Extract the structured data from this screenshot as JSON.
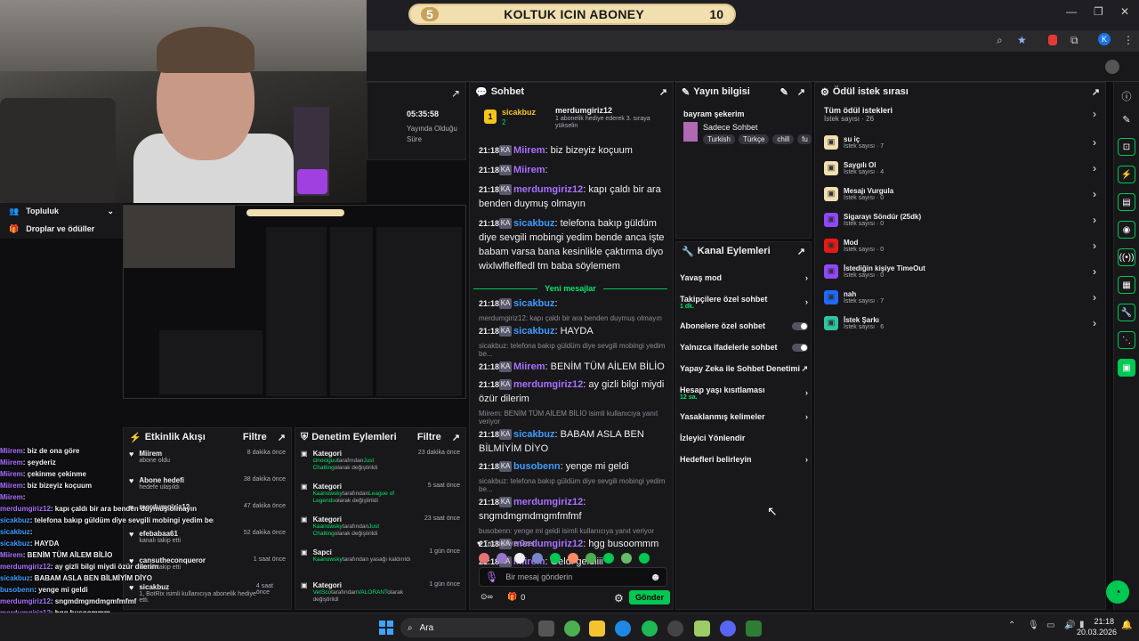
{
  "goal_bar": {
    "left_value": "5",
    "label": "KOLTUK ICIN ABONEY",
    "right_value": "10"
  },
  "stream_info": {
    "uptime": "05:35:58",
    "uptime_label": "Yayında Olduğu Süre"
  },
  "left_nav": {
    "community": "Topluluk",
    "drops": "Droplar ve ödüller"
  },
  "chat": {
    "title": "Sohbet",
    "pinned": {
      "user": "sicakbuz",
      "count": "2",
      "recipient": "merdumgiriz12",
      "text": "1 abonelik hediye ederek 3. sıraya yükselin",
      "rank": "1"
    },
    "messages": [
      {
        "time": "21:18",
        "user": "Miirem",
        "text": ": biz bizeyiz koçuum",
        "color": "#a970ff"
      },
      {
        "time": "21:18",
        "user": "Miirem",
        "text": ":",
        "color": "#a970ff"
      },
      {
        "time": "21:18",
        "user": "merdumgiriz12",
        "text": ": kapı çaldı bir ara benden duymuş olmayın",
        "color": "#a970ff"
      },
      {
        "time": "21:18",
        "user": "sicakbuz",
        "text": ": telefona bakıp güldüm diye sevgili mobingi yedim bende anca işte babam varsa bana kesinlikle çaktırma diyo wixlwlflelfledl tm baba söylemem",
        "color": "#3d9bff"
      }
    ],
    "new_messages": "Yeni mesajlar",
    "messages2": [
      {
        "time": "21:18",
        "user": "sicakbuz",
        "text": ":",
        "color": "#3d9bff",
        "reply": ""
      },
      {
        "time": "21:18",
        "user": "sicakbuz",
        "text": ": HAYDA",
        "color": "#3d9bff",
        "reply": "merdumgiriz12: kapı çaldı bir ara benden duymuş olmayın"
      },
      {
        "time": "21:18",
        "user": "Miirem",
        "text": ": BENİM TÜM AİLEM BİLİO",
        "color": "#a970ff",
        "reply": "sicakbuz: telefona bakıp güldüm diye sevgili mobingi yedim be..."
      },
      {
        "time": "21:18",
        "user": "merdumgiriz12",
        "text": ": ay gizli bilgi miydi özür dilerim",
        "color": "#a970ff",
        "reply": ""
      },
      {
        "time": "21:18",
        "user": "sicakbuz",
        "text": ": BABAM ASLA BEN BİLMİYİM DİYO",
        "color": "#3d9bff",
        "reply": "Miirem: BENİM TÜM AİLEM BİLİO isimli kullanıcıya yanıt veriyor"
      },
      {
        "time": "21:18",
        "user": "busobenn",
        "text": ": yenge mi geldi",
        "color": "#3d9bff",
        "reply": ""
      },
      {
        "time": "21:18",
        "user": "merdumgiriz12",
        "text": ": sngmdmgmdmgmfmfmf",
        "color": "#a970ff",
        "reply": "sicakbuz: telefona bakıp güldüm diye sevgili mobingi yedim be..."
      },
      {
        "time": "21:18",
        "user": "merdumgiriz12",
        "text": ": hgg busoommm",
        "color": "#a970ff",
        "reply": "busobenn: yenge mi geldi isimli kullanıcıya yanıt veriyor"
      },
      {
        "time": "21:18",
        "user": "Miirem",
        "text": ": Geldi geldiiii",
        "color": "#a970ff",
        "reply": ""
      }
    ],
    "followers_only": "Takipçilere Özel",
    "input_placeholder": "Bir mesaj gönderin",
    "points": "0",
    "send": "Gönder"
  },
  "stream_info_panel": {
    "title": "Yayın bilgisi",
    "stream_title": "bayram şekerim",
    "category": "Sadece Sohbet",
    "tags": [
      "Turkish",
      "Türkçe",
      "chill",
      "fu"
    ]
  },
  "channel_actions": {
    "title": "Kanal Eylemleri",
    "items": [
      {
        "label": "Yavaş mod",
        "sub": "",
        "kind": "chevron"
      },
      {
        "label": "Takipçilere özel sohbet",
        "sub": "1 dk.",
        "kind": "chevron"
      },
      {
        "label": "Abonelere özel sohbet",
        "sub": "",
        "kind": "toggle"
      },
      {
        "label": "Yalnızca ifadelerle sohbet",
        "sub": "",
        "kind": "toggle"
      },
      {
        "label": "Yapay Zeka ile Sohbet Denetimi",
        "sub": "",
        "kind": "external"
      },
      {
        "label": "Hesap yaşı kısıtlaması",
        "sub": "12 sa.",
        "kind": "chevron"
      },
      {
        "label": "Yasaklanmış kelimeler",
        "sub": "",
        "kind": "chevron"
      },
      {
        "label": "İzleyici Yönlendir",
        "sub": "",
        "kind": "none"
      },
      {
        "label": "Hedefleri belirleyin",
        "sub": "",
        "kind": "chevron"
      }
    ]
  },
  "rewards": {
    "title": "Ödül istek sırası",
    "all": "Tüm ödül istekleri",
    "all_count": "İstek sayısı · 26",
    "items": [
      {
        "label": "su iç",
        "count": "İstek sayısı · 7",
        "color": "#f1dfb0"
      },
      {
        "label": "Saygılı Ol",
        "count": "İstek sayısı · 4",
        "color": "#f1dfb0"
      },
      {
        "label": "Mesajı Vurgula",
        "count": "İstek sayısı · 0",
        "color": "#f1dfb0"
      },
      {
        "label": "Sigarayı Söndür (25dk)",
        "count": "İstek sayısı · 0",
        "color": "#9147ff"
      },
      {
        "label": "Mod",
        "count": "İstek sayısı · 0",
        "color": "#e91916"
      },
      {
        "label": "İstediğin kişiye TimeOut",
        "count": "İstek sayısı · 0",
        "color": "#9147ff"
      },
      {
        "label": "nah",
        "count": "İstek sayısı · 7",
        "color": "#1f69ff"
      },
      {
        "label": "İstek Şarkı",
        "count": "İstek sayısı · 6",
        "color": "#2ec4a0"
      }
    ]
  },
  "activity": {
    "title": "Etkinlik Akışı",
    "filter": "Filtre",
    "items": [
      {
        "name": "Miirem",
        "desc": "abone oldu",
        "time": "8 dakika önce"
      },
      {
        "name": "Abone hedefi",
        "desc": "hedefe ulaşıldı",
        "time": "38 dakika önce"
      },
      {
        "name": "merdumgiriz12",
        "desc": "",
        "time": "47 dakika önce"
      },
      {
        "name": "efebabaa61",
        "desc": "kanalı takip etti",
        "time": "52 dakika önce"
      },
      {
        "name": "cansutheconqueror",
        "desc": "kanalı takip etti",
        "time": "1 saat önce"
      },
      {
        "name": "sicakbuz",
        "desc": "1, BotRix isimli kullanıcıya abonelik hediye etti.",
        "time": "4 saat önce"
      }
    ]
  },
  "moderation": {
    "title": "Denetim Eylemleri",
    "filter": "Filtre",
    "items": [
      {
        "type": "Kategori",
        "actor": "cinociguu",
        "mid": "tarafından",
        "target": "Just Chatting",
        "rest": "olarak değiştirildi",
        "time": "23 dakika önce"
      },
      {
        "type": "Kategori",
        "actor": "Kaanowsky",
        "mid": "tarafından",
        "target": "League of Legends",
        "rest": "olarak değiştirildi",
        "time": "5 saat önce"
      },
      {
        "type": "Kategori",
        "actor": "Kaanowsky",
        "mid": "tarafından",
        "target": "Just Chatting",
        "rest": "olarak değiştirildi",
        "time": "23 saat önce"
      },
      {
        "type": "Sapci",
        "actor": "Kaanowsky",
        "mid": "tarafından yasağı kaldırıldı",
        "target": "",
        "rest": "",
        "time": "1 gün önce"
      },
      {
        "type": "Kategori",
        "actor": "VetSco",
        "mid": "tarafından",
        "target": "VALORANT",
        "rest": "olarak değiştirildi",
        "time": "1 gün önce"
      },
      {
        "type": "Kategori",
        "actor": "",
        "mid": "",
        "target": "",
        "rest": "",
        "time": ""
      }
    ]
  },
  "overlay_chat": [
    {
      "user": "Miirem",
      "text": ": biz de ona göre"
    },
    {
      "user": "Miirem",
      "text": ": şeyderiz"
    },
    {
      "user": "Miirem",
      "text": ": çekinme çekinme"
    },
    {
      "user": "Miirem",
      "text": ": biz bizeyiz koçuum"
    },
    {
      "user": "Miirem",
      "text": ":"
    },
    {
      "user": "merdumgiriz12",
      "text": ": kapı çaldı bir ara benden duymuş olmayın"
    },
    {
      "user": "sicakbuz",
      "text": ": telefona bakıp güldüm diye sevgili mobingi yedim bende anca işte babam varsa bana kesinlikle çaktırma diyo wixlwlflelfledl tm baba söylemem"
    },
    {
      "user": "sicakbuz",
      "text": ":"
    },
    {
      "user": "sicakbuz",
      "text": ": HAYDA"
    },
    {
      "user": "Miirem",
      "text": ": BENİM TÜM AİLEM BİLİO"
    },
    {
      "user": "merdumgiriz12",
      "text": ": ay gizli bilgi miydi özür dilerim"
    },
    {
      "user": "sicakbuz",
      "text": ": BABAM ASLA BEN BİLMİYİM DİYO"
    },
    {
      "user": "busobenn",
      "text": ": yenge mi geldi"
    },
    {
      "user": "merdumgiriz12",
      "text": ": sngmdmgmdmgmfmfmf"
    },
    {
      "user": "merdumgiriz12",
      "text": ": hgg busoommm"
    },
    {
      "user": "Miirem",
      "text": ": Geldi geldiiii"
    }
  ],
  "taskbar": {
    "search": "Ara",
    "time": "21:18",
    "date": "20.03.2026"
  },
  "colors": {
    "accent": "#00c853",
    "purple": "#a970ff",
    "bg": "#18181b"
  }
}
